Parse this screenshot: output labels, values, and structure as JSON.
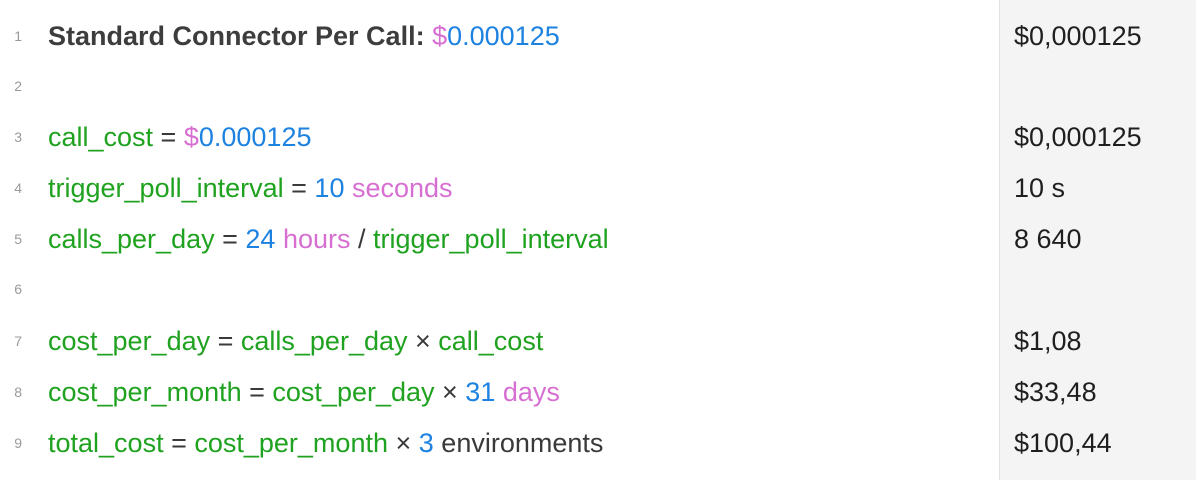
{
  "colors": {
    "variable": "#1fa21f",
    "number": "#1d82e0",
    "unit": "#d76fd2",
    "text": "#3a3a3a",
    "results_background": "#f4f4f4"
  },
  "lines": [
    {
      "number": "1",
      "tokens": [
        {
          "text": "Standard Connector Per Call: ",
          "type": "heading"
        },
        {
          "text": "$",
          "type": "unit"
        },
        {
          "text": "0.000125",
          "type": "num"
        }
      ],
      "result": "$0,000125"
    },
    {
      "number": "2",
      "tokens": [],
      "result": ""
    },
    {
      "number": "3",
      "tokens": [
        {
          "text": "call_cost",
          "type": "var"
        },
        {
          "text": " = ",
          "type": "op"
        },
        {
          "text": "$",
          "type": "unit"
        },
        {
          "text": "0.000125",
          "type": "num"
        }
      ],
      "result": "$0,000125"
    },
    {
      "number": "4",
      "tokens": [
        {
          "text": "trigger_poll_interval",
          "type": "var"
        },
        {
          "text": " = ",
          "type": "op"
        },
        {
          "text": "10",
          "type": "num"
        },
        {
          "text": " seconds",
          "type": "unit"
        }
      ],
      "result": "10 s"
    },
    {
      "number": "5",
      "tokens": [
        {
          "text": "calls_per_day",
          "type": "var"
        },
        {
          "text": " = ",
          "type": "op"
        },
        {
          "text": "24",
          "type": "num"
        },
        {
          "text": " hours",
          "type": "unit"
        },
        {
          "text": " / ",
          "type": "op"
        },
        {
          "text": "trigger_poll_interval",
          "type": "var"
        }
      ],
      "result": "8 640"
    },
    {
      "number": "6",
      "tokens": [],
      "result": ""
    },
    {
      "number": "7",
      "tokens": [
        {
          "text": "cost_per_day",
          "type": "var"
        },
        {
          "text": " = ",
          "type": "op"
        },
        {
          "text": "calls_per_day",
          "type": "var"
        },
        {
          "text": " × ",
          "type": "op"
        },
        {
          "text": "call_cost",
          "type": "var"
        }
      ],
      "result": "$1,08"
    },
    {
      "number": "8",
      "tokens": [
        {
          "text": "cost_per_month",
          "type": "var"
        },
        {
          "text": " = ",
          "type": "op"
        },
        {
          "text": "cost_per_day",
          "type": "var"
        },
        {
          "text": " × ",
          "type": "op"
        },
        {
          "text": "31",
          "type": "num"
        },
        {
          "text": " days",
          "type": "unit"
        }
      ],
      "result": "$33,48"
    },
    {
      "number": "9",
      "tokens": [
        {
          "text": "total_cost",
          "type": "var"
        },
        {
          "text": " = ",
          "type": "op"
        },
        {
          "text": "cost_per_month",
          "type": "var"
        },
        {
          "text": " × ",
          "type": "op"
        },
        {
          "text": "3",
          "type": "num"
        },
        {
          "text": " environments",
          "type": "plain"
        }
      ],
      "result": "$100,44"
    }
  ]
}
